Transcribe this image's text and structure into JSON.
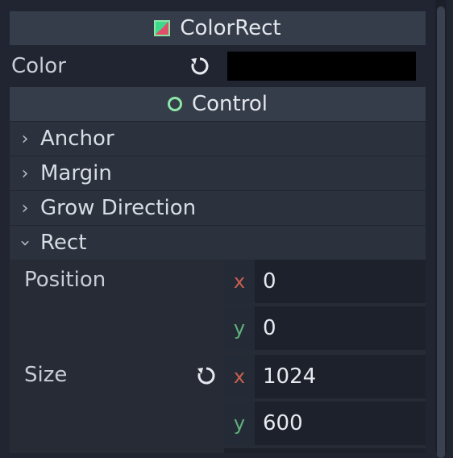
{
  "colorrect_header": {
    "title": "ColorRect",
    "icon": "colorrect-icon"
  },
  "color_row": {
    "label": "Color",
    "value_color": "#000000"
  },
  "control_header": {
    "title": "Control",
    "icon": "control-icon"
  },
  "sections": {
    "anchor": "Anchor",
    "margin": "Margin",
    "grow_direction": "Grow Direction",
    "rect": "Rect"
  },
  "rect": {
    "position": {
      "label": "Position",
      "x_label": "x",
      "x": "0",
      "y_label": "y",
      "y": "0"
    },
    "size": {
      "label": "Size",
      "x_label": "x",
      "x": "1024",
      "y_label": "y",
      "y": "600"
    }
  },
  "colors": {
    "accent_green": "#8ce6a6",
    "axis_x": "#c8604e",
    "axis_y": "#5fb37c",
    "panel_bg": "#202531"
  }
}
